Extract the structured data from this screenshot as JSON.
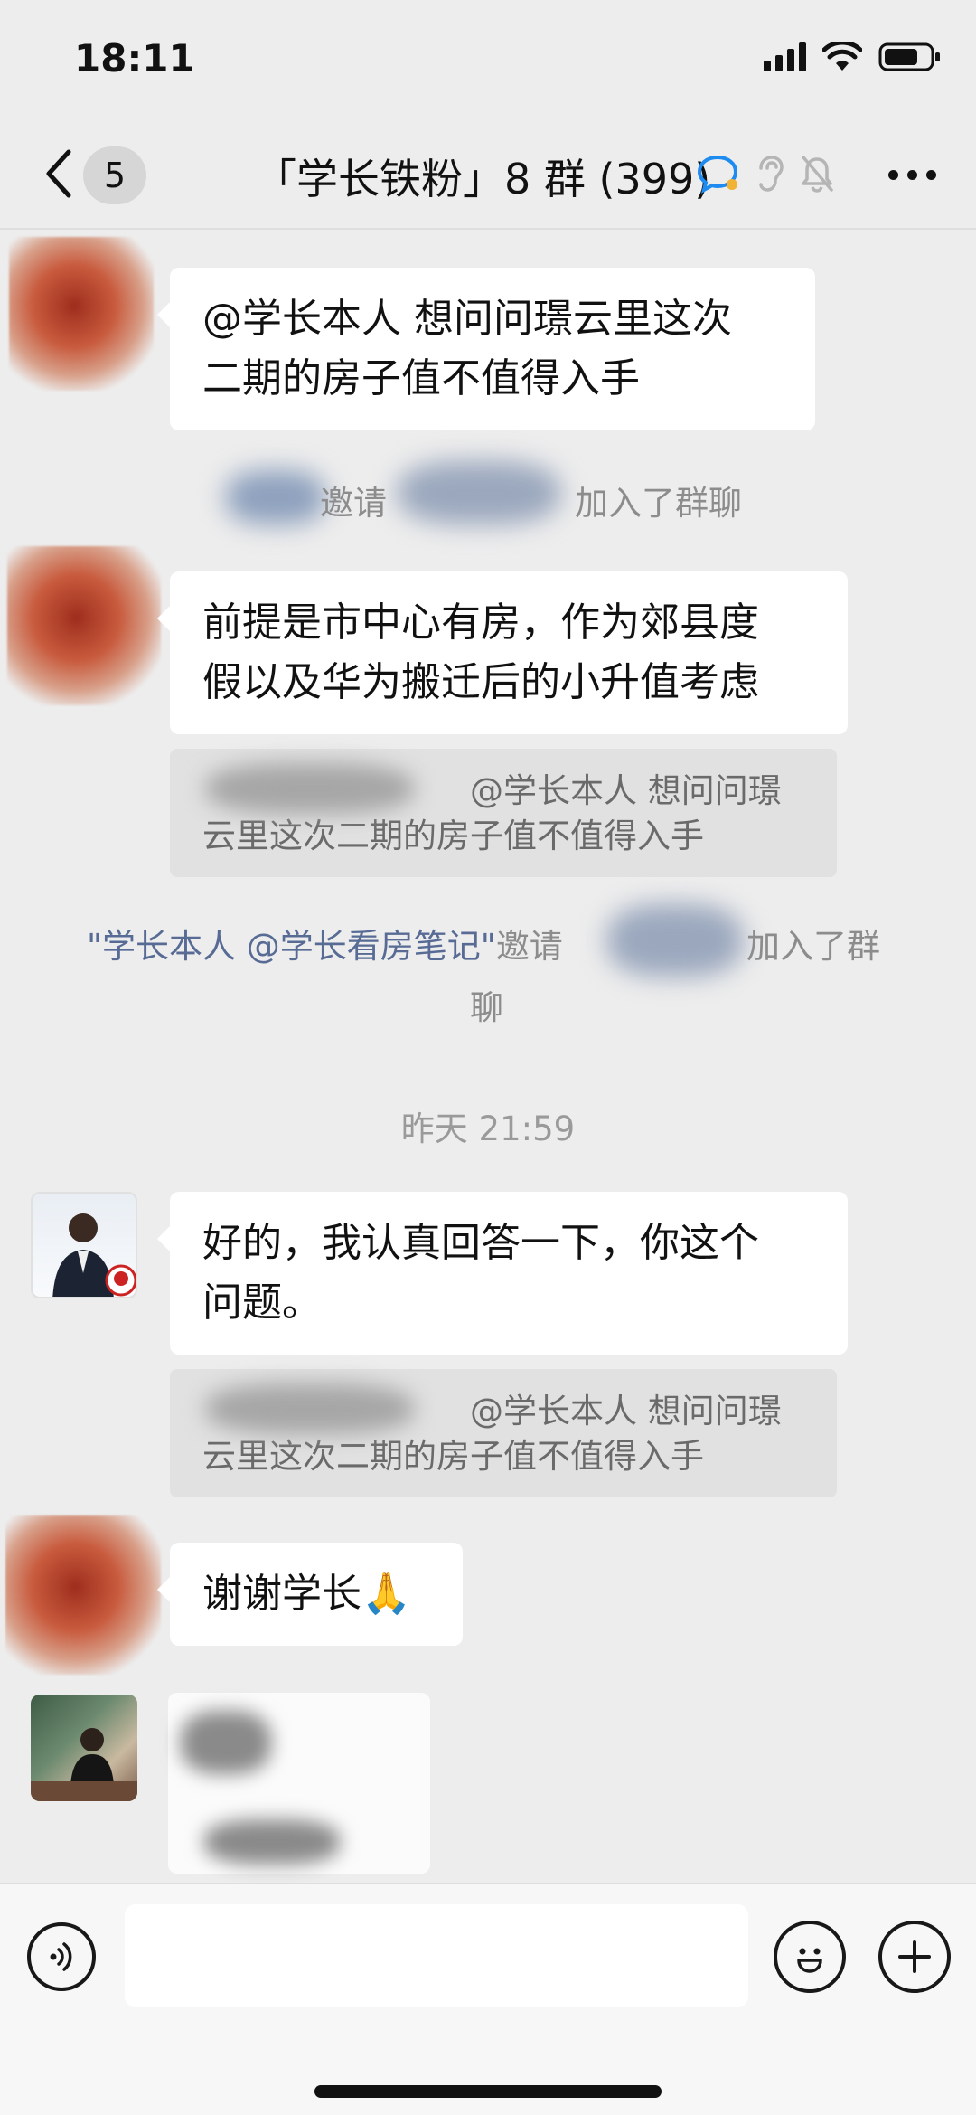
{
  "status_bar": {
    "time": "18:11"
  },
  "nav": {
    "unread_count": "5",
    "title": "「学长铁粉」8 群 (399)"
  },
  "messages": [
    {
      "text_line1": "@学长本人 想问问璟云里这次",
      "text_line2": "二期的房子值不值得入手"
    },
    {
      "text_line1": "前提是市中心有房，作为郊县度",
      "text_line2": "假以及华为搬迁后的小升值考虑",
      "quote_line1": "@学长本人 想问问璟",
      "quote_line2": "云里这次二期的房子值不值得入手"
    },
    {
      "text_line1": "好的，我认真回答一下，你这个",
      "text_line2": "问题。",
      "quote_line1": "@学长本人 想问问璟",
      "quote_line2": "云里这次二期的房子值不值得入手"
    },
    {
      "text": "谢谢学长🙏"
    }
  ],
  "system_messages": {
    "invite1_part1": "邀请",
    "invite1_part2": "加入了群聊",
    "invite2_link": "\"学长本人 @学长看房笔记\"",
    "invite2_part1": "邀请",
    "invite2_part2": "加入了群",
    "invite2_part3": "聊"
  },
  "timestamp": "昨天 21:59",
  "colors": {
    "background": "#ededed",
    "bubble": "#ffffff",
    "link": "#576b95",
    "quote": "#e1e1e1"
  },
  "icons": [
    "back-chevron-icon",
    "signal-icon",
    "wifi-icon",
    "battery-icon",
    "chat-bubble-icon",
    "ear-icon",
    "mute-bell-icon",
    "more-icon",
    "voice-icon",
    "emoji-icon",
    "plus-icon"
  ]
}
